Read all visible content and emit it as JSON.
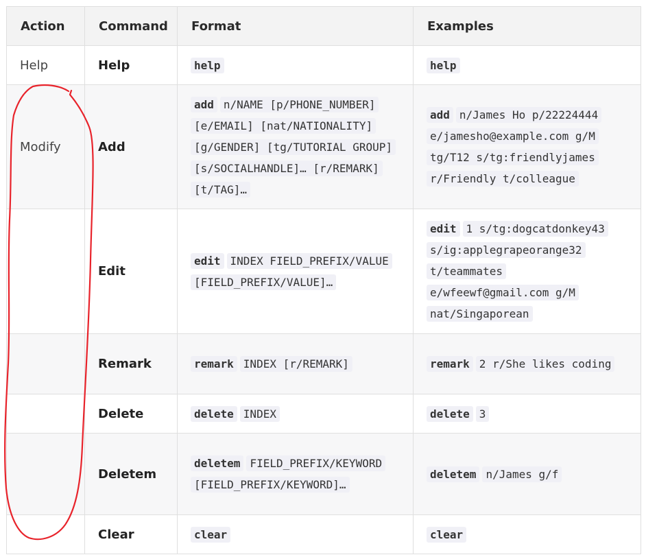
{
  "headers": {
    "action": "Action",
    "command": "Command",
    "format": "Format",
    "examples": "Examples"
  },
  "rows": [
    {
      "action": "Help",
      "command": "Help",
      "format_kw": "help",
      "format_rest": "",
      "example_kw": "help",
      "example_rest": ""
    },
    {
      "action": "Modify",
      "command": "Add",
      "format_kw": "add",
      "format_rest": "n/NAME [p/PHONE_NUMBER] [e/EMAIL] [nat/NATIONALITY] [g/GENDER] [tg/TUTORIAL GROUP] [s/SOCIALHANDLE]… [r/REMARK] [t/TAG]…",
      "example_kw": "add",
      "example_rest": "n/James Ho p/22224444 e/jamesho@example.com g/M tg/T12 s/tg:friendlyjames r/Friendly t/colleague"
    },
    {
      "action": "",
      "command": "Edit",
      "format_kw": "edit",
      "format_rest": "INDEX FIELD_PREFIX/VALUE [FIELD_PREFIX/VALUE]…",
      "example_kw": "edit",
      "example_rest": "1 s/tg:dogcatdonkey43 s/ig:applegrapeorange32 t/teammates e/wfeewf@gmail.com g/M nat/Singaporean"
    },
    {
      "action": "",
      "command": "Remark",
      "format_kw": "remark",
      "format_rest": "INDEX [r/REMARK]",
      "example_kw": "remark",
      "example_rest": "2 r/She likes coding"
    },
    {
      "action": "",
      "command": "Delete",
      "format_kw": "delete",
      "format_rest": "INDEX",
      "example_kw": "delete",
      "example_rest": "3"
    },
    {
      "action": "",
      "command": "Deletem",
      "format_kw": "deletem",
      "format_rest": "FIELD_PREFIX/KEYWORD [FIELD_PREFIX/KEYWORD]…",
      "example_kw": "deletem",
      "example_rest": "n/James g/f"
    },
    {
      "action": "",
      "command": "Clear",
      "format_kw": "clear",
      "format_rest": "",
      "example_kw": "clear",
      "example_rest": ""
    }
  ],
  "annotation": {
    "color": "#e8232b",
    "shape": "hand-drawn-ellipse"
  }
}
